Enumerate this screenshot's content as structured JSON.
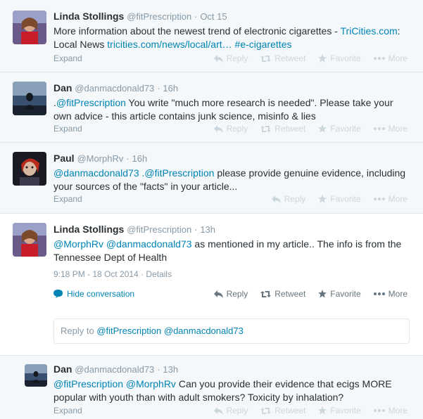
{
  "action_labels": {
    "reply": "Reply",
    "retweet": "Retweet",
    "favorite": "Favorite",
    "more": "More",
    "expand": "Expand"
  },
  "tweets": [
    {
      "fullname": "Linda Stollings",
      "screenname": "@fitPrescription",
      "dot": "·",
      "time": "Oct 15",
      "text_plain": "More information about the newest trend of electronic cigarettes - ",
      "link1": "TriCities.com",
      "text_mid": ": Local News ",
      "link2": "tricities.com/news/local/art…",
      "hashtag": "#e-cigarettes"
    },
    {
      "fullname": "Dan",
      "screenname": "@danmacdonald73",
      "dot": "·",
      "time": "16h",
      "prefix": ".",
      "mention": "@fitPrescription",
      "text_plain": " You write \"much more research is needed\". Please take your own advice - this article contains junk science, misinfo & lies"
    },
    {
      "fullname": "Paul",
      "screenname": "@MorphRv",
      "dot": "·",
      "time": "16h",
      "mention1": "@danmacdonald73",
      "mention2": " .@fitPrescription",
      "text_plain": " please provide genuine evidence, including your sources of the \"facts\" in your article..."
    },
    {
      "fullname": "Linda Stollings",
      "screenname": "@fitPrescription",
      "dot": "·",
      "time": "13h",
      "mention1": "@MorphRv",
      "mention2": " @danmacdonald73",
      "text_plain": " as mentioned in my article.. The info is from the Tennessee Dept of Health",
      "timestamp": "9:18 PM - 18 Oct 2014",
      "details_sep": " · ",
      "details": "Details",
      "hide_conversation": "Hide conversation"
    },
    {
      "fullname": "Dan",
      "screenname": "@danmacdonald73",
      "dot": "·",
      "time": "13h",
      "mention1": "@fitPrescription",
      "mention2": " @MorphRv",
      "text_plain": " Can you provide their evidence that ecigs MORE popular with youth than with adult smokers? Toxicity by inhalation?"
    }
  ],
  "reply_box": {
    "prefix": "Reply to ",
    "mention1": "@fitPrescription",
    "mention2": " @danmacdonald73"
  },
  "colors": {
    "link": "#0084b4",
    "muted": "#8899a6",
    "text": "#292f33",
    "bg_collapsed": "#f5f8fa",
    "border": "#e1e8ed"
  }
}
